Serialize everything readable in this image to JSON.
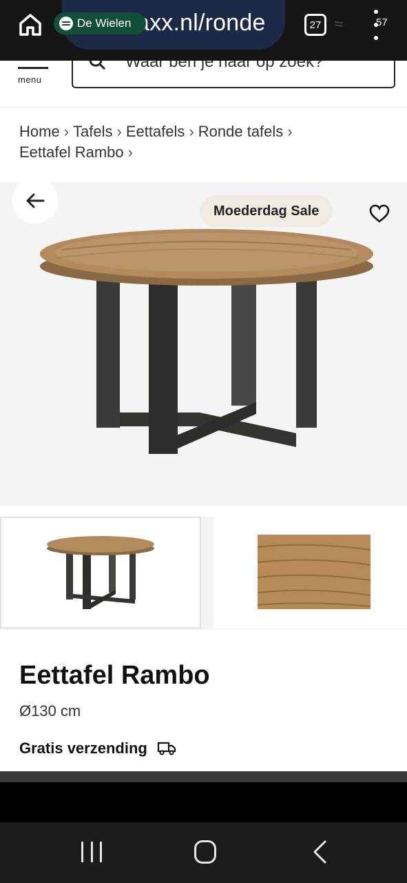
{
  "status_bar": {
    "url": "axx.nl/ronde",
    "media_title": "De Wielen",
    "tab_count": "27",
    "battery": "57"
  },
  "header": {
    "menu_label": "menu",
    "search_placeholder": "Waar ben je naar op zoek?"
  },
  "breadcrumb": {
    "items": [
      "Home",
      "Tafels",
      "Eettafels",
      "Ronde tafels",
      "Eettafel Rambo"
    ],
    "separator": "›"
  },
  "product": {
    "badge": "Moederdag Sale",
    "title": "Eettafel Rambo",
    "size": "Ø130 cm",
    "shipping": "Gratis verzending"
  },
  "icons": [
    "home-icon",
    "spotify-icon",
    "tabs-icon",
    "more-icon",
    "search-icon",
    "back-arrow-icon",
    "heart-icon",
    "truck-icon"
  ],
  "colors": {
    "browser_bar": "#161616",
    "url_pill": "#1c2a47",
    "spotify": "#134e3a",
    "badge_bg": "#efeae2",
    "hero_bg": "#f4f4f4"
  }
}
